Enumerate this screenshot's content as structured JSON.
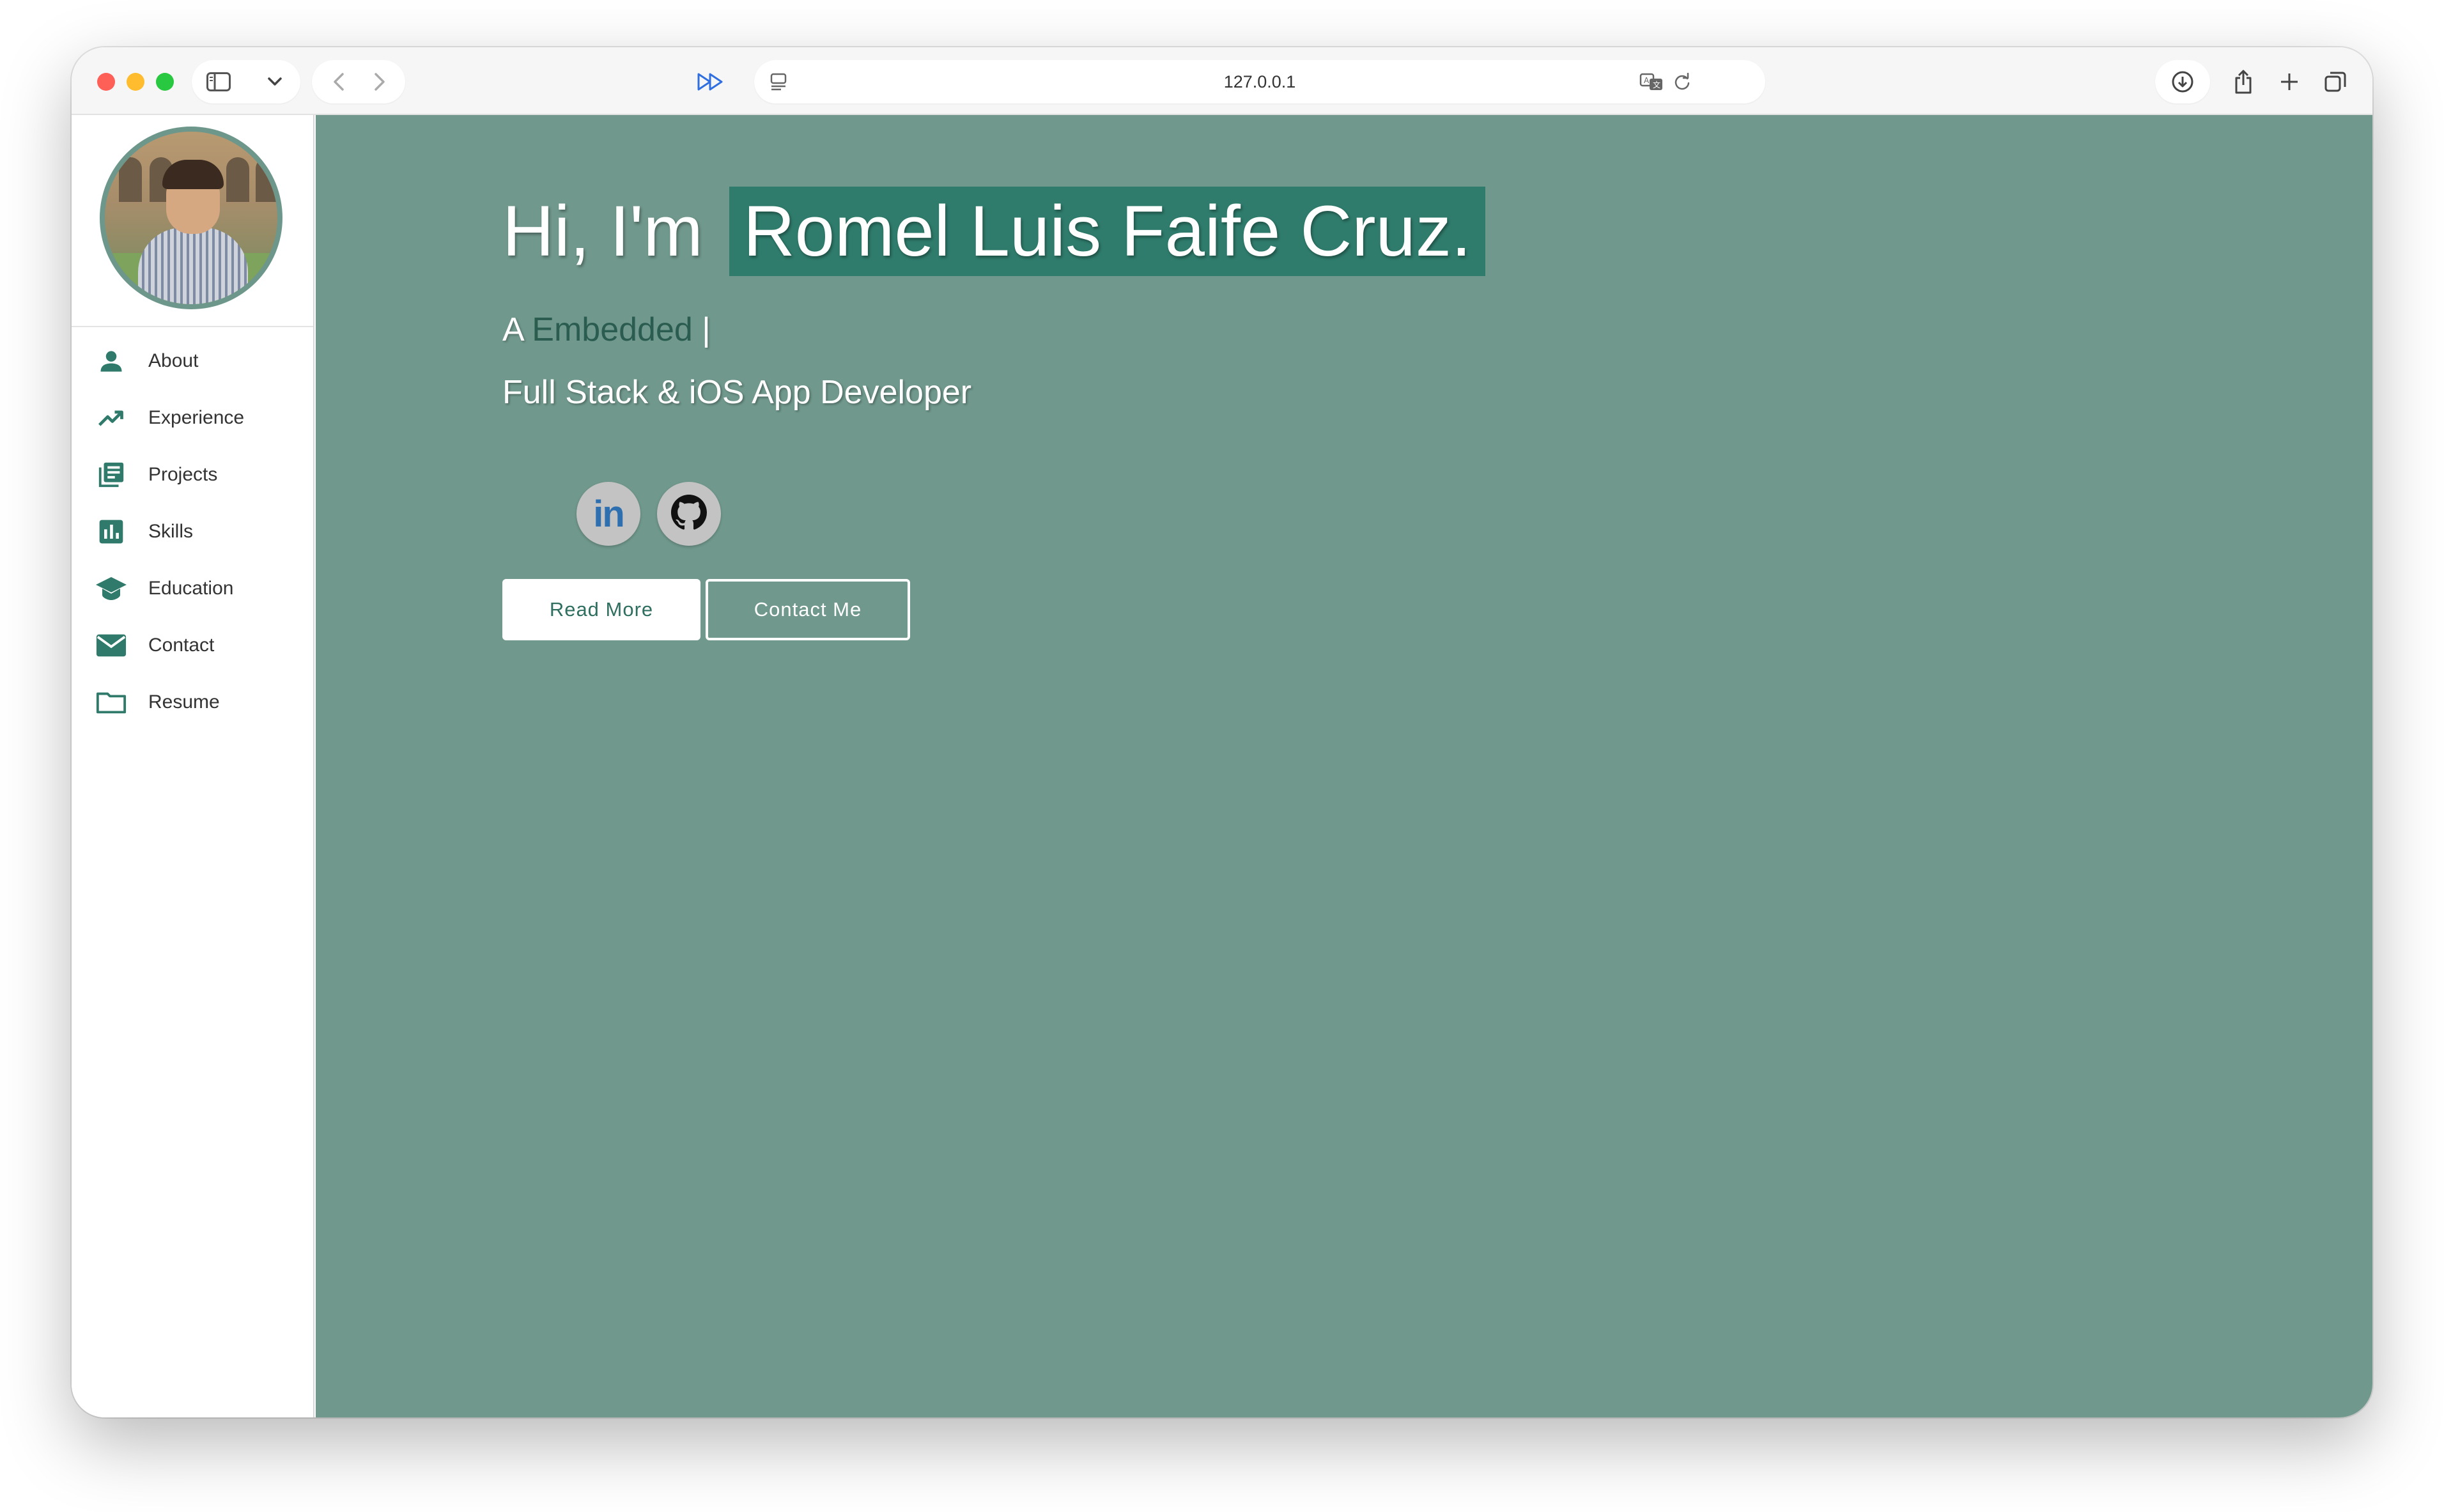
{
  "browser": {
    "url": "127.0.0.1",
    "traffic_lights": [
      "close",
      "minimize",
      "zoom"
    ]
  },
  "sidebar": {
    "avatar_alt": "",
    "items": [
      {
        "label": "About",
        "icon": "person-icon"
      },
      {
        "label": "Experience",
        "icon": "trending-up-icon"
      },
      {
        "label": "Projects",
        "icon": "library-books-icon"
      },
      {
        "label": "Skills",
        "icon": "bar-chart-icon"
      },
      {
        "label": "Education",
        "icon": "graduation-cap-icon"
      },
      {
        "label": "Contact",
        "icon": "mail-icon"
      },
      {
        "label": "Resume",
        "icon": "folder-icon"
      }
    ]
  },
  "hero": {
    "greeting": "Hi, I'm",
    "name": "Romel Luis Faife Cruz.",
    "typed_prefix": "A",
    "typed_word": "Embedded",
    "typed_cursor": "|",
    "role": "Full Stack & iOS App Developer",
    "read_more_label": "Read More",
    "contact_label": "Contact Me",
    "linkedin_label": "in"
  },
  "colors": {
    "accent": "#2f7c6c",
    "main_bg": "#70988c",
    "sidebar_icon": "#2f7a6a"
  }
}
